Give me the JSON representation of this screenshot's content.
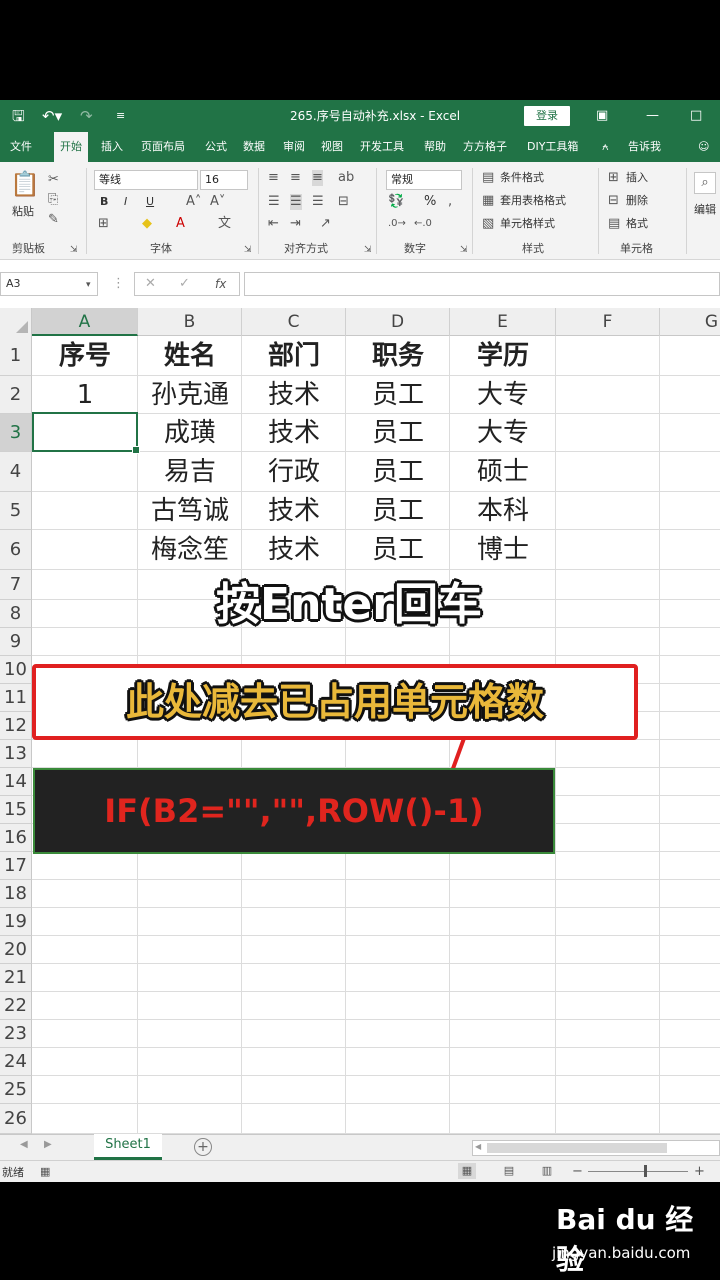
{
  "window": {
    "doc_title": "265.序号自动补充.xlsx  -  Excel",
    "login_label": "登录"
  },
  "tabs": [
    "文件",
    "开始",
    "插入",
    "页面布局",
    "公式",
    "数据",
    "审阅",
    "视图",
    "开发工具",
    "帮助",
    "方方格子",
    "DIY工具箱",
    "告诉我"
  ],
  "ribbon": {
    "clipboard": {
      "paste": "粘贴",
      "label": "剪贴板"
    },
    "font": {
      "name": "等线",
      "size": "16",
      "label": "字体",
      "bold": "B",
      "italic": "I",
      "underline": "U"
    },
    "alignment": {
      "label": "对齐方式"
    },
    "number": {
      "format": "常规",
      "label": "数字",
      "percent": "%"
    },
    "styles": {
      "cond_format": "条件格式",
      "table_format": "套用表格格式",
      "cell_styles": "单元格样式",
      "label": "样式"
    },
    "cells": {
      "insert": "插入",
      "delete": "删除",
      "format": "格式",
      "label": "单元格"
    },
    "editing": {
      "label": "编辑"
    }
  },
  "formula_bar": {
    "name_box": "A3",
    "fx": "fx"
  },
  "sheet": {
    "columns": [
      "A",
      "B",
      "C",
      "D",
      "E",
      "F",
      "G"
    ],
    "rows": [
      "1",
      "2",
      "3",
      "4",
      "5",
      "6",
      "7",
      "8",
      "9",
      "10",
      "11",
      "12",
      "13",
      "14",
      "15",
      "16",
      "17",
      "18",
      "19",
      "20",
      "21",
      "22",
      "23",
      "24",
      "25",
      "26"
    ],
    "cells": [
      [
        "序号",
        "姓名",
        "部门",
        "职务",
        "学历"
      ],
      [
        "1",
        "孙克通",
        "技术",
        "员工",
        "大专"
      ],
      [
        "",
        "成璜",
        "技术",
        "员工",
        "大专"
      ],
      [
        "",
        "易吉",
        "行政",
        "员工",
        "硕士"
      ],
      [
        "",
        "古笃诚",
        "技术",
        "员工",
        "本科"
      ],
      [
        "",
        "梅念笙",
        "技术",
        "员工",
        "博士"
      ]
    ]
  },
  "overlays": {
    "enter_hint": "按Enter回车",
    "subtract_hint": "此处减去已占用单元格数",
    "formula": "IF(B2=\"\",\"\",ROW()-1)"
  },
  "sheet_tabs": {
    "active": "Sheet1"
  },
  "status": {
    "ready": "就绪"
  },
  "watermark": {
    "logo": "Bai du 经验",
    "url": "jingyan.baidu.com"
  }
}
